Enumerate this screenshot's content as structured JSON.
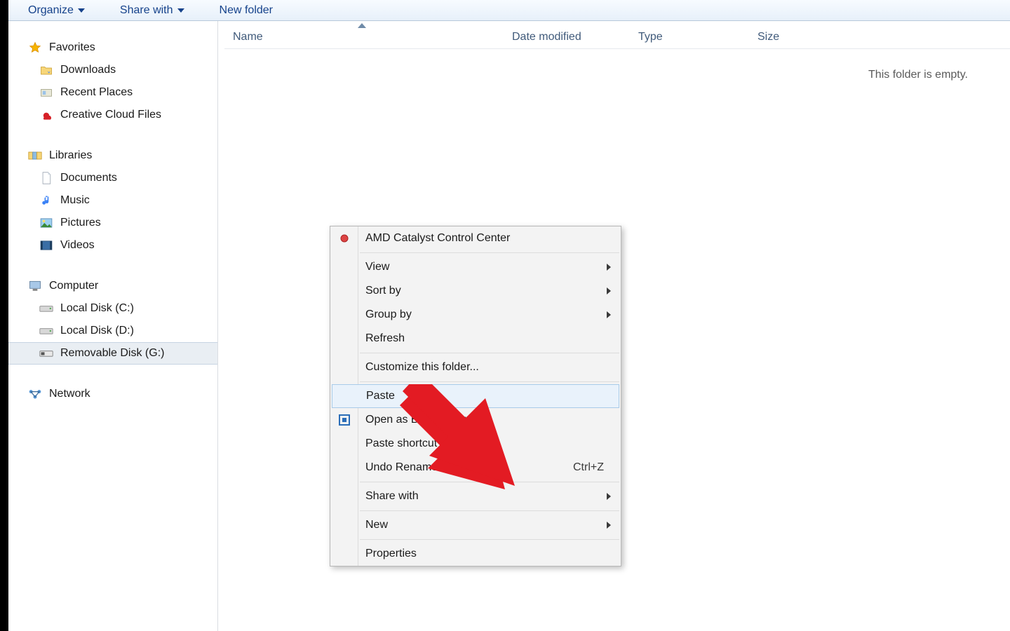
{
  "toolbar": {
    "organize": "Organize",
    "share_with": "Share with",
    "new_folder": "New folder"
  },
  "sidebar": {
    "favorites": {
      "header": "Favorites",
      "downloads": "Downloads",
      "recent_places": "Recent Places",
      "creative_cloud": "Creative Cloud Files"
    },
    "libraries": {
      "header": "Libraries",
      "documents": "Documents",
      "music": "Music",
      "pictures": "Pictures",
      "videos": "Videos"
    },
    "computer": {
      "header": "Computer",
      "local_c": "Local Disk (C:)",
      "local_d": "Local Disk (D:)",
      "removable_g": "Removable Disk (G:)"
    },
    "network": {
      "header": "Network"
    }
  },
  "columns": {
    "name": "Name",
    "date_modified": "Date modified",
    "type": "Type",
    "size": "Size"
  },
  "content": {
    "empty": "This folder is empty."
  },
  "context_menu": {
    "amd": "AMD Catalyst Control Center",
    "view": "View",
    "sort_by": "Sort by",
    "group_by": "Group by",
    "refresh": "Refresh",
    "customize": "Customize this folder...",
    "paste": "Paste",
    "open_brackets": "Open as Brackets project",
    "paste_shortcut": "Paste shortcut",
    "undo_rename": "Undo Rename",
    "undo_shortcut": "Ctrl+Z",
    "share_with": "Share with",
    "new": "New",
    "properties": "Properties"
  }
}
